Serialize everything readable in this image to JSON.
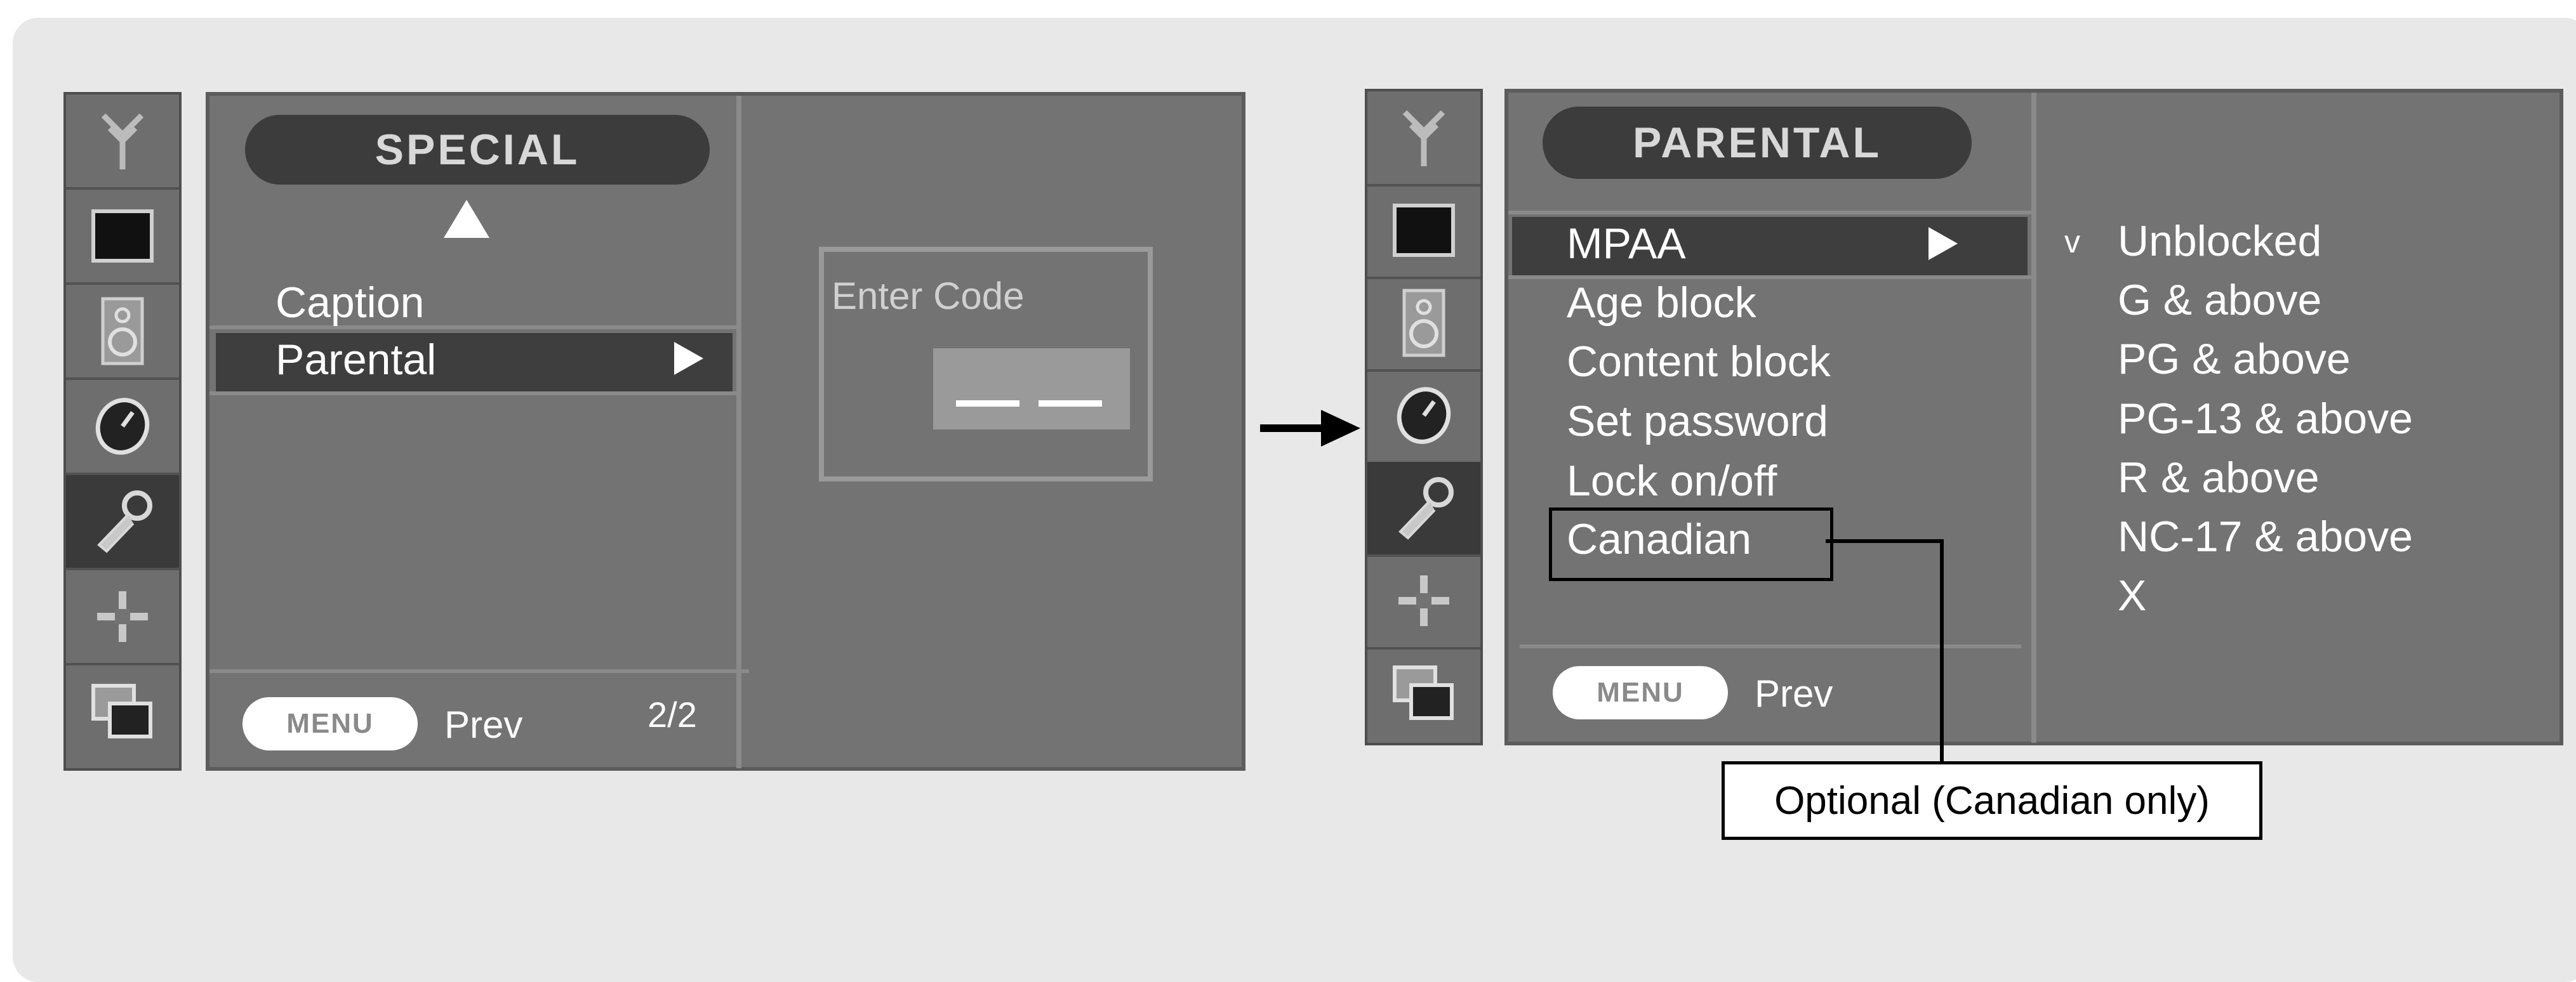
{
  "left_screen": {
    "title": "SPECIAL",
    "items": [
      {
        "label": "Caption",
        "selected": false
      },
      {
        "label": "Parental",
        "selected": true
      }
    ],
    "menu_button": "MENU",
    "prev_label": "Prev",
    "page_indicator": "2/2",
    "code_dialog": {
      "label": "Enter Code"
    }
  },
  "right_screen": {
    "title": "PARENTAL",
    "items": [
      {
        "label": "MPAA",
        "selected": true
      },
      {
        "label": "Age block",
        "selected": false
      },
      {
        "label": "Content block",
        "selected": false
      },
      {
        "label": "Set password",
        "selected": false
      },
      {
        "label": "Lock on/off",
        "selected": false
      },
      {
        "label": "Canadian",
        "selected": false
      }
    ],
    "check_mark": "v",
    "options": [
      "Unblocked",
      "G & above",
      "PG & above",
      "PG-13 & above",
      "R & above",
      "NC-17 & above",
      "X"
    ],
    "menu_button": "MENU",
    "prev_label": "Prev"
  },
  "annotation": {
    "label": "Optional (Canadian only)"
  },
  "icons": [
    "antenna-icon",
    "picture-icon",
    "speaker-icon",
    "clock-icon",
    "key-icon",
    "plus-icon",
    "pip-icon"
  ],
  "colors": {
    "screen_bg": "#737373",
    "highlight": "#3e3e3e",
    "strip_selected": "#3a3a3a",
    "text": "#ffffff"
  }
}
